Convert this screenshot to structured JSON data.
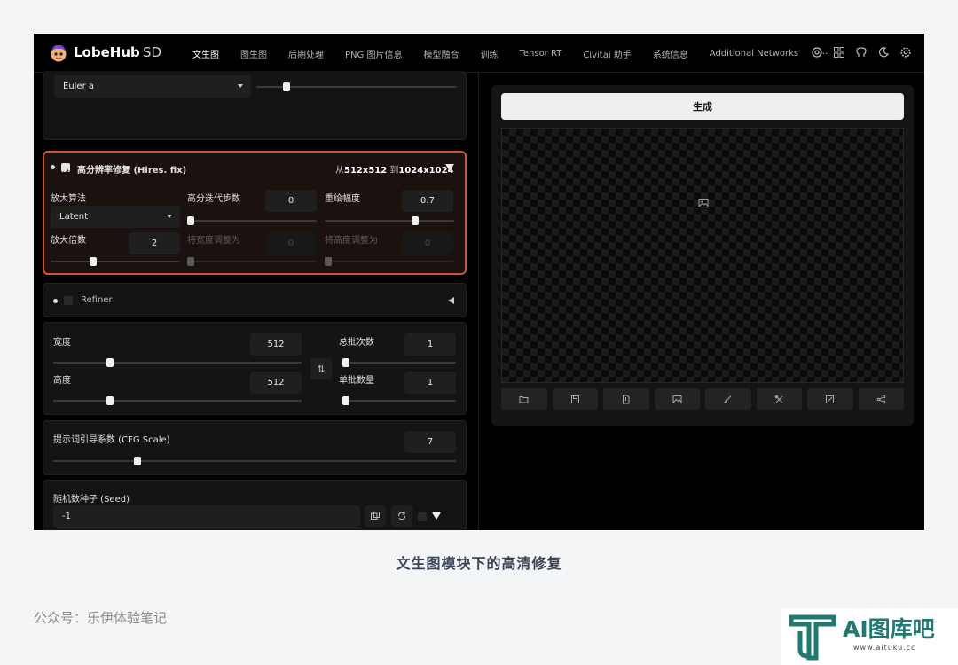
{
  "header": {
    "brand": "LobeHub",
    "brand_suffix": "SD",
    "tabs": [
      {
        "label": "文生图",
        "active": true
      },
      {
        "label": "图生图"
      },
      {
        "label": "后期处理"
      },
      {
        "label": "PNG 图片信息"
      },
      {
        "label": "模型融合"
      },
      {
        "label": "训练"
      },
      {
        "label": "Tensor RT"
      },
      {
        "label": "Civitai 助手"
      },
      {
        "label": "系统信息"
      },
      {
        "label": "Additional Networks"
      }
    ],
    "more": "···",
    "icons": [
      "settings-gear-icon",
      "grid-icon",
      "github-icon",
      "moon-icon",
      "gear-icon"
    ]
  },
  "sampler": {
    "value": "Euler a",
    "steps_fraction": 0.15
  },
  "hires": {
    "title": "高分辨率修复 (Hires. fix)",
    "from_label": "从",
    "from_size": "512x512",
    "to_label": "到",
    "to_size": "1024x1024",
    "upscaler_label": "放大算法",
    "upscaler_value": "Latent",
    "steps_label": "高分迭代步数",
    "steps_value": "0",
    "steps_fraction": 0.0,
    "denoise_label": "重绘幅度",
    "denoise_value": "0.7",
    "denoise_fraction": 0.7,
    "scale_label": "放大倍数",
    "scale_value": "2",
    "scale_fraction": 0.33,
    "resize_w_label": "将宽度调整为",
    "resize_w_value": "0",
    "resize_h_label": "将高度调整为",
    "resize_h_value": "0"
  },
  "refiner": {
    "label": "Refiner"
  },
  "size": {
    "width_label": "宽度",
    "width_value": "512",
    "width_fraction": 0.23,
    "height_label": "高度",
    "height_value": "512",
    "height_fraction": 0.23,
    "batch_count_label": "总批次数",
    "batch_count_value": "1",
    "batch_count_fraction": 0.0,
    "batch_size_label": "单批数量",
    "batch_size_value": "1",
    "batch_size_fraction": 0.0,
    "swap_symbol": "⇅"
  },
  "cfg": {
    "label": "提示词引导系数 (CFG Scale)",
    "value": "7",
    "fraction": 0.21
  },
  "seed": {
    "label": "随机数种子 (Seed)",
    "value": "-1"
  },
  "output": {
    "generate_label": "生成",
    "toolbar": [
      "folder-icon",
      "save-icon",
      "zip-icon",
      "image-icon",
      "brush-icon",
      "tools-icon",
      "edit-icon",
      "share-icon"
    ]
  },
  "caption": "文生图模块下的高清修复",
  "credit": "公众号：乐伊体验笔记",
  "watermark": {
    "text": "AI图库吧",
    "url": "www.aituku.cc"
  }
}
